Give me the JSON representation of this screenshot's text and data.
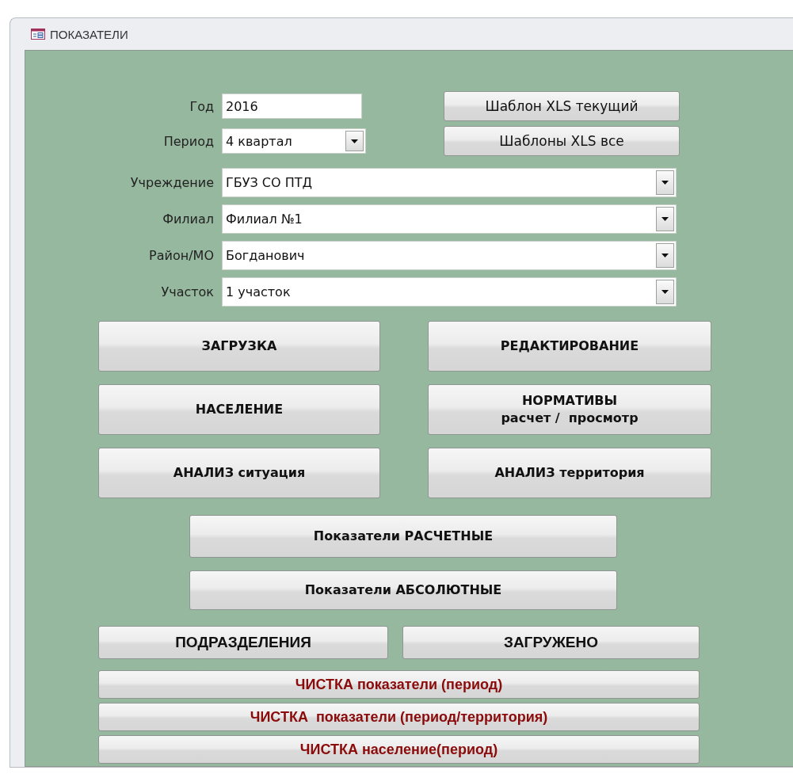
{
  "window": {
    "title": "ПОКАЗАТЕЛИ"
  },
  "fields": [
    {
      "label": "Год",
      "value": "2016",
      "kind": "text"
    },
    {
      "label": "Период",
      "value": "4 квартал",
      "kind": "combo"
    }
  ],
  "template_buttons": [
    "Шаблон XLS текущий",
    "Шаблоны XLS все"
  ],
  "combos": [
    {
      "label": "Учреждение",
      "value": "ГБУЗ СО ПТД"
    },
    {
      "label": "Филиал",
      "value": "Филиал №1"
    },
    {
      "label": "Район/МО",
      "value": "Богданович"
    },
    {
      "label": "Участок",
      "value": "1 участок"
    }
  ],
  "main_buttons": [
    "ЗАГРУЗКА",
    "НАСЕЛЕНИЕ",
    "АНАЛИЗ ситуация",
    "РЕДАКТИРОВАНИЕ",
    "НОРМАТИВЫ\nрасчет /  просмотр",
    "АНАЛИЗ территория"
  ],
  "indicator_buttons": [
    "Показатели РАСЧЕТНЫЕ",
    "Показатели АБСОЛЮТНЫЕ"
  ],
  "section_buttons": [
    "ПОДРАЗДЕЛЕНИЯ",
    "ЗАГРУЖЕНО"
  ],
  "cleanup_buttons": [
    "ЧИСТКА показатели (период)",
    "ЧИСТКА  показатели (период/территория)",
    "ЧИСТКА население(период)"
  ]
}
